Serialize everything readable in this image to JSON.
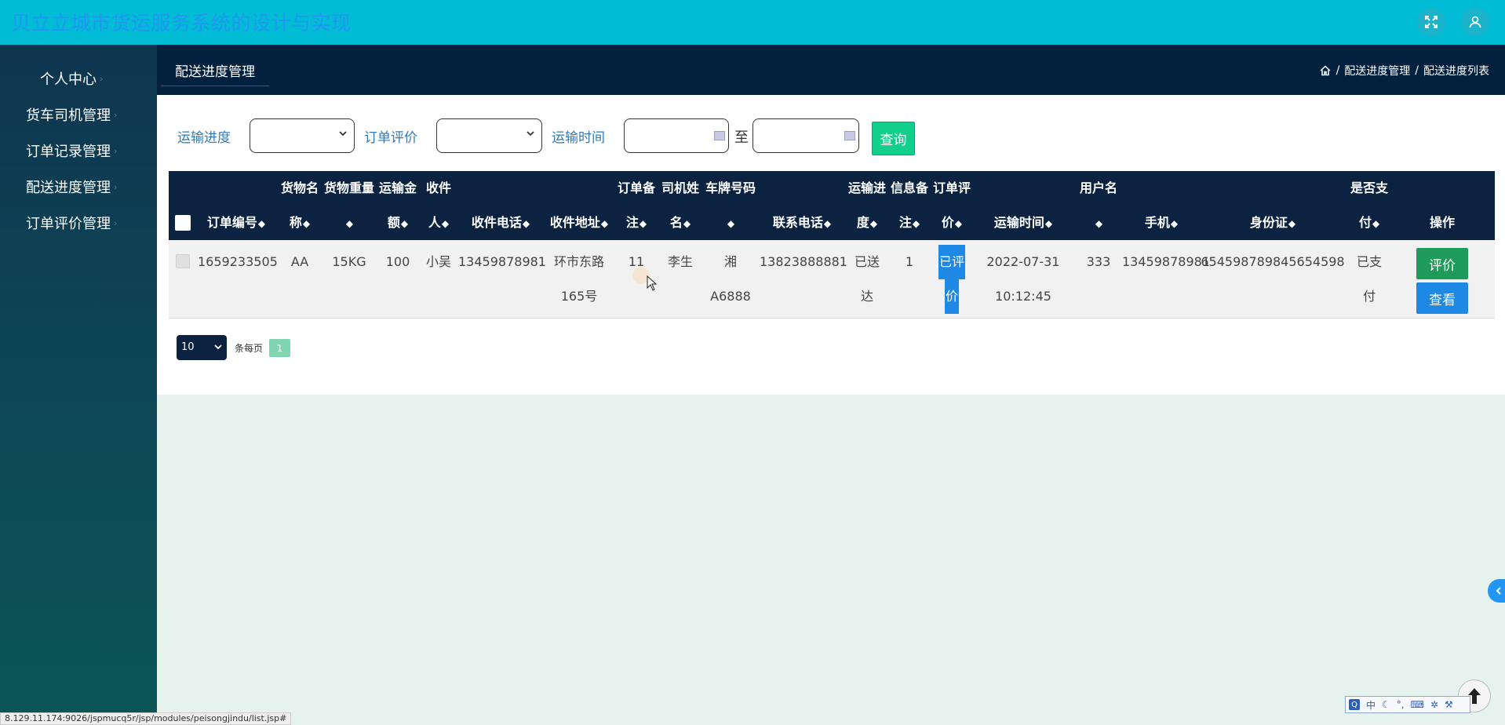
{
  "app": {
    "title": "贝立立城市货运服务系统的设计与实现",
    "fullscreen_icon": "fullscreen-icon",
    "user_icon": "user-icon"
  },
  "sidebar": {
    "items": [
      {
        "label": "个人中心"
      },
      {
        "label": "货车司机管理"
      },
      {
        "label": "订单记录管理"
      },
      {
        "label": "配送进度管理"
      },
      {
        "label": "订单评价管理"
      }
    ]
  },
  "header": {
    "tab": "配送进度管理",
    "breadcrumb": {
      "sep": "/",
      "level1": "配送进度管理",
      "level2": "配送进度列表"
    }
  },
  "filters": {
    "progress_label": "运输进度",
    "progress_value": "",
    "rating_label": "订单评价",
    "rating_value": "",
    "time_label": "运输时间",
    "time_from": "",
    "to_label": "至",
    "time_to": "",
    "query_label": "查询"
  },
  "table": {
    "columns": [
      {
        "l1": "",
        "l2": "订单编号"
      },
      {
        "l1": "货物名",
        "l2": "称"
      },
      {
        "l1": "货物重量",
        "l2": ""
      },
      {
        "l1": "运输金",
        "l2": "额"
      },
      {
        "l1": "收件",
        "l2": "人"
      },
      {
        "l1": "",
        "l2": "收件电话"
      },
      {
        "l1": "",
        "l2": "收件地址"
      },
      {
        "l1": "订单备",
        "l2": "注"
      },
      {
        "l1": "司机姓",
        "l2": "名"
      },
      {
        "l1": "车牌号码",
        "l2": ""
      },
      {
        "l1": "",
        "l2": "联系电话"
      },
      {
        "l1": "运输进",
        "l2": "度"
      },
      {
        "l1": "信息备",
        "l2": "注"
      },
      {
        "l1": "订单评",
        "l2": "价"
      },
      {
        "l1": "",
        "l2": "运输时间"
      },
      {
        "l1": "用户名",
        "l2": ""
      },
      {
        "l1": "",
        "l2": "手机"
      },
      {
        "l1": "",
        "l2": "身份证"
      },
      {
        "l1": "是否支",
        "l2": "付"
      }
    ],
    "sort_glyph": "◆",
    "action_header": "操作",
    "rows": [
      {
        "order_no": "1659233505",
        "goods_name": "AA",
        "weight": "15KG",
        "amount": "100",
        "recipient": "小吴",
        "recipient_phone": "13459878981",
        "address_l1": "环市东路",
        "address_l2": "165号",
        "order_note": "11",
        "driver": "李生",
        "plate_l1": "湘",
        "plate_l2": "A6888",
        "contact_phone": "13823888881",
        "progress_l1": "已送",
        "progress_l2": "达",
        "info_note": "1",
        "rating_l1": "已评",
        "rating_l2": "价",
        "time_l1": "2022-07-31",
        "time_l2": "10:12:45",
        "username": "333",
        "mobile": "13459878981",
        "id_card": "654598789845654598",
        "paid_l1": "已支",
        "paid_l2": "付",
        "actions": {
          "evaluate": "评价",
          "view": "查看"
        }
      }
    ]
  },
  "pagination": {
    "page_size": "10",
    "per_page_label": "条每页",
    "current_page": "1"
  },
  "status_bar": {
    "url": "8.129.11.174:9026/jspmucq5r/jsp/modules/peisongjindu/list.jsp#"
  },
  "ime": {
    "logo": "Q",
    "mode": "中"
  }
}
